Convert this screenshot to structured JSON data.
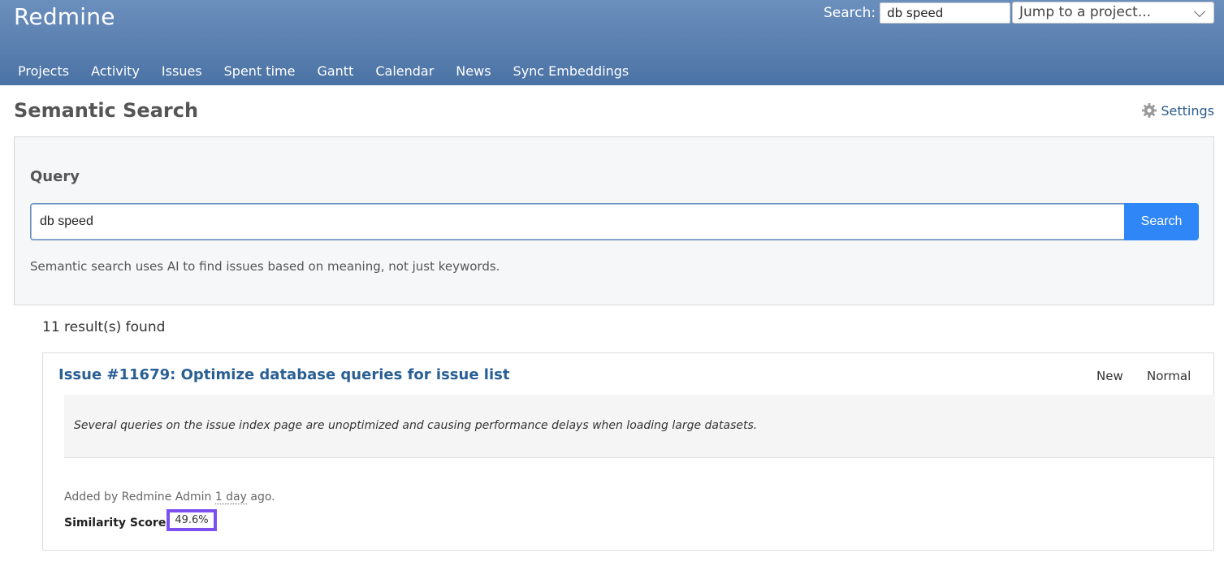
{
  "header": {
    "app_title": "Redmine",
    "search_label": "Search:",
    "search_value": "db speed",
    "project_jump": "Jump to a project...",
    "menu": [
      "Projects",
      "Activity",
      "Issues",
      "Spent time",
      "Gantt",
      "Calendar",
      "News",
      "Sync Embeddings"
    ]
  },
  "page": {
    "title": "Semantic Search",
    "settings_label": "Settings"
  },
  "query": {
    "label": "Query",
    "value": "db speed",
    "search_button": "Search",
    "help": "Semantic search uses AI to find issues based on meaning, not just keywords."
  },
  "results": {
    "count": "11 result(s) found",
    "items": [
      {
        "title": "Issue #11679: Optimize database queries for issue list",
        "status": "New",
        "priority": "Normal",
        "description": "Several queries on the issue index page are unoptimized and causing performance delays when loading large datasets.",
        "added_prefix": "Added by Redmine Admin",
        "added_time": "1 day",
        "added_suffix": "ago.",
        "similarity_label": "Similarity Score",
        "similarity_value": "49.6%"
      }
    ]
  },
  "colors": {
    "header_top": "#6b8fbd",
    "header_bottom": "#4a72a4",
    "link": "#2a5f94",
    "button": "#2f86f6",
    "highlight": "#7b4ff0"
  }
}
